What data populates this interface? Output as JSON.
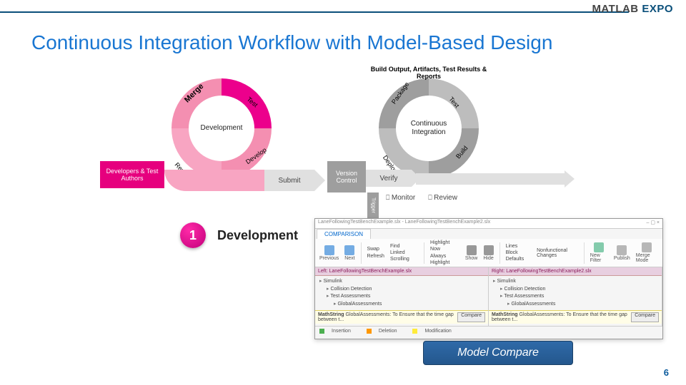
{
  "brand": {
    "ml": "MATLAB ",
    "expo": "EXPO"
  },
  "title": "Continuous Integration Workflow with Model-Based Design",
  "page_number": "6",
  "diagram": {
    "dev_cycle_center": "Development",
    "dev_cycle_phases": {
      "merge": "Merge",
      "test": "Test",
      "develop": "Develop",
      "review": "Review"
    },
    "ci_cycle_center": "Continuous Integration",
    "ci_cycle_phases": {
      "package": "Package",
      "test": "Test",
      "build": "Build",
      "deploy": "Deploy"
    },
    "arc_text": "Build Output, Artifacts, Test Results & Reports",
    "dev_box": "Developers & Test Authors",
    "submit": "Submit",
    "version_control": "Version Control",
    "verify": "Verify",
    "trigger": "Trigger",
    "monitor": "Monitor",
    "review": "Review"
  },
  "step": {
    "number": "1",
    "title": "Development"
  },
  "screenshot": {
    "window_title": "LaneFollowingTestBenchExample.slx - LaneFollowingTestBenchExample2.slx",
    "tab": "COMPARISON",
    "toolbar": {
      "previous": "Previous",
      "next": "Next",
      "swap": "Swap",
      "refresh": "Refresh",
      "find": "Find",
      "linked": "Linked Scrolling",
      "highlight_now": "Highlight Now",
      "always": "Always Highlight",
      "show": "Show",
      "hide": "Hide",
      "lines": "Lines",
      "block_defaults": "Block Defaults",
      "nonfunc": "Nonfunctional Changes",
      "new_filter": "New Filter",
      "publish": "Publish",
      "merge_mode": "Merge Mode"
    },
    "left_header": "Left: LaneFollowingTestBenchExample.slx",
    "right_header": "Right: LaneFollowingTestBenchExample2.slx",
    "tree_root": "Simulink",
    "tree_items": [
      "Collision Detection",
      "Test Assessments",
      "GlobalAssessments"
    ],
    "compare_row_label": "MathString",
    "compare_row_desc": "GlobalAssessments: To Ensure that the time gap between t...",
    "compare_btn": "Compare",
    "legend": {
      "insertion": "Insertion",
      "deletion": "Deletion",
      "modification": "Modification"
    }
  },
  "caption": "Model Compare"
}
